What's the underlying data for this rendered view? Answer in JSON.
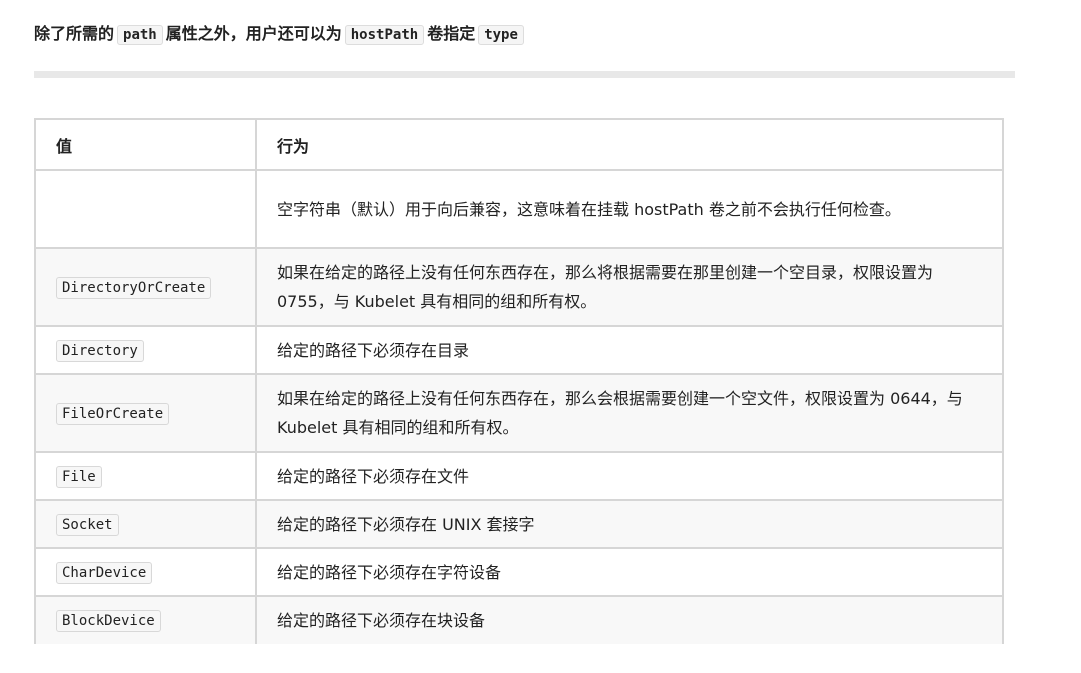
{
  "intro": {
    "text_1": "除了所需的",
    "code_1": "path",
    "text_2": "属性之外，用户还可以为",
    "code_2": "hostPath",
    "text_3": "卷指定",
    "code_3": "type"
  },
  "table": {
    "headers": [
      "值",
      "行为"
    ],
    "rows": [
      {
        "value": "",
        "behavior": "空字符串（默认）用于向后兼容，这意味着在挂载 hostPath 卷之前不会执行任何检查。"
      },
      {
        "value": "DirectoryOrCreate",
        "behavior": "如果在给定的路径上没有任何东西存在，那么将根据需要在那里创建一个空目录，权限设置为 0755，与 Kubelet 具有相同的组和所有权。"
      },
      {
        "value": "Directory",
        "behavior": "给定的路径下必须存在目录"
      },
      {
        "value": "FileOrCreate",
        "behavior": "如果在给定的路径上没有任何东西存在，那么会根据需要创建一个空文件，权限设置为 0644，与 Kubelet 具有相同的组和所有权。"
      },
      {
        "value": "File",
        "behavior": "给定的路径下必须存在文件"
      },
      {
        "value": "Socket",
        "behavior": "给定的路径下必须存在 UNIX 套接字"
      },
      {
        "value": "CharDevice",
        "behavior": "给定的路径下必须存在字符设备"
      },
      {
        "value": "BlockDevice",
        "behavior": "给定的路径下必须存在块设备"
      }
    ]
  }
}
